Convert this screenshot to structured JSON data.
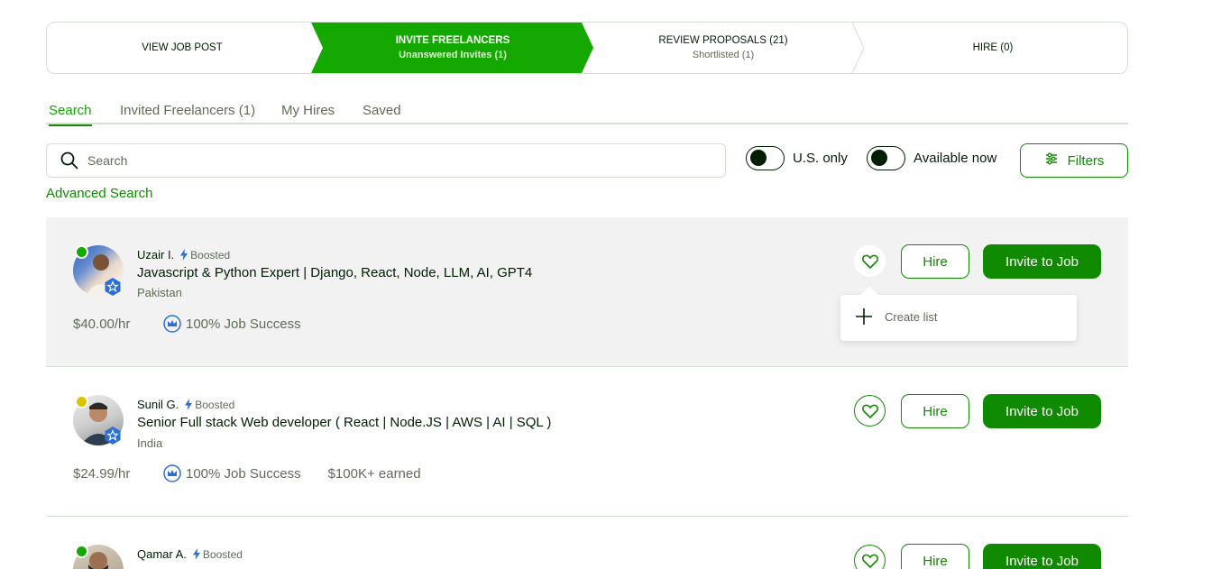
{
  "steps": [
    {
      "label": "View job post",
      "sub": ""
    },
    {
      "label": "Invite freelancers",
      "sub": "Unanswered Invites (1)"
    },
    {
      "label": "Review proposals (21)",
      "sub": "Shortlisted (1)"
    },
    {
      "label": "Hire (0)",
      "sub": ""
    }
  ],
  "tabs": [
    {
      "label": "Search",
      "active": true
    },
    {
      "label": "Invited Freelancers (1)"
    },
    {
      "label": "My Hires"
    },
    {
      "label": "Saved"
    }
  ],
  "search": {
    "placeholder": "Search"
  },
  "toggles": {
    "us_only": "U.S. only",
    "available_now": "Available now"
  },
  "filters_label": "Filters",
  "advanced_search": "Advanced Search",
  "boosted_label": "Boosted",
  "buttons": {
    "hire": "Hire",
    "invite": "Invite to Job"
  },
  "dropdown": {
    "create_list": "Create list"
  },
  "colors": {
    "brand": "#108a00",
    "active_step": "#14a800",
    "online": "#14a800",
    "away": "#d8c400",
    "badge": "#2b6fd6"
  },
  "freelancers": [
    {
      "name": "Uzair I.",
      "title": "Javascript & Python Expert | Django, React, Node, LLM, AI, GPT4",
      "country": "Pakistan",
      "rate": "$40.00/hr",
      "jss": "100% Job Success",
      "earned": "",
      "status": "online"
    },
    {
      "name": "Sunil G.",
      "title": "Senior Full stack Web developer ( React | Node.JS | AWS | AI | SQL )",
      "country": "India",
      "rate": "$24.99/hr",
      "jss": "100% Job Success",
      "earned": "$100K+ earned",
      "status": "away"
    },
    {
      "name": "Qamar A.",
      "title": "",
      "country": "",
      "rate": "",
      "jss": "",
      "earned": "",
      "status": "online"
    }
  ]
}
